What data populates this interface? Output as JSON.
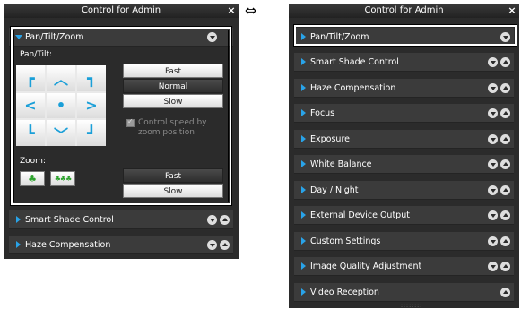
{
  "left_panel": {
    "title": "Control for Admin",
    "close": "×",
    "ptz_section": {
      "label": "Pan/Tilt/Zoom"
    },
    "pan_tilt_label": "Pan/Tilt:",
    "pad": [
      "┏",
      "︿",
      "┓",
      "<",
      "•",
      ">",
      "┗",
      "﹀",
      "┛"
    ],
    "speed_buttons": [
      "Fast",
      "Normal",
      "Slow"
    ],
    "speed_selected": "Normal",
    "zoom_speed_check_label": "Control speed by zoom position",
    "zoom_label": "Zoom:",
    "zoom_buttons": [
      {
        "name": "zoom-wide-icon",
        "glyph": "♣"
      },
      {
        "name": "zoom-tele-icon",
        "glyph": "♣♣♣"
      }
    ],
    "zoom_speed_buttons": [
      "Fast",
      "Slow"
    ],
    "zoom_speed_selected": "Fast",
    "sections": [
      "Smart Shade Control",
      "Haze Compensation"
    ]
  },
  "swap_symbol": "⇔",
  "right_panel": {
    "title": "Control for Admin",
    "close": "×",
    "sections": [
      {
        "label": "Pan/Tilt/Zoom",
        "down": true,
        "up": false
      },
      {
        "label": "Smart Shade Control",
        "down": true,
        "up": true
      },
      {
        "label": "Haze Compensation",
        "down": true,
        "up": true
      },
      {
        "label": "Focus",
        "down": true,
        "up": true
      },
      {
        "label": "Exposure",
        "down": true,
        "up": true
      },
      {
        "label": "White Balance",
        "down": true,
        "up": true
      },
      {
        "label": "Day / Night",
        "down": true,
        "up": true
      },
      {
        "label": "External Device Output",
        "down": true,
        "up": true
      },
      {
        "label": "Custom Settings",
        "down": true,
        "up": true
      },
      {
        "label": "Image Quality Adjustment",
        "down": true,
        "up": true
      },
      {
        "label": "Video Reception",
        "down": false,
        "up": true
      }
    ],
    "resize_handle": "::::::::"
  },
  "colors": {
    "panel": "#2b2b2b",
    "section": "#3b3b3b",
    "accent": "#29a3e8",
    "pad_arrow": "#1a9fd8"
  }
}
